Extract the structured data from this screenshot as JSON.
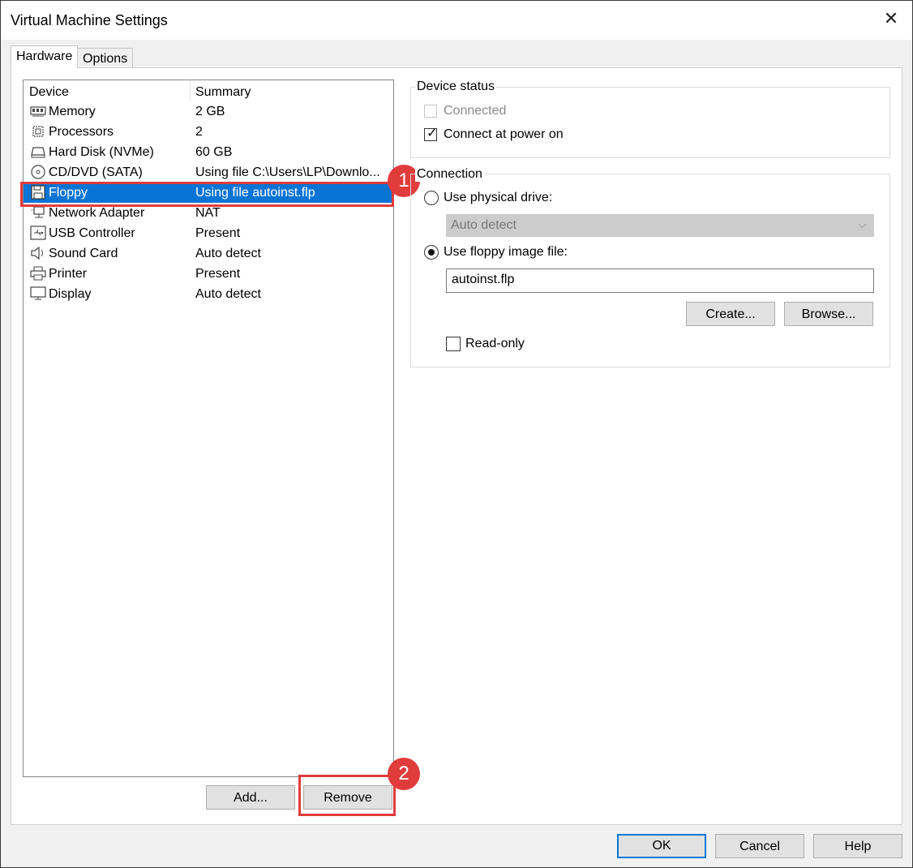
{
  "window": {
    "title": "Virtual Machine Settings",
    "close_glyph": "✕"
  },
  "tabs": [
    {
      "label": "Hardware",
      "active": true
    },
    {
      "label": "Options",
      "active": false
    }
  ],
  "device_list": {
    "columns": {
      "device": "Device",
      "summary": "Summary"
    },
    "items": [
      {
        "name": "Memory",
        "summary": "2 GB",
        "icon": "memory-icon"
      },
      {
        "name": "Processors",
        "summary": "2",
        "icon": "processor-icon"
      },
      {
        "name": "Hard Disk (NVMe)",
        "summary": "60 GB",
        "icon": "hard-disk-icon"
      },
      {
        "name": "CD/DVD (SATA)",
        "summary": "Using file C:\\Users\\LP\\Downlo...",
        "icon": "cd-dvd-icon"
      },
      {
        "name": "Floppy",
        "summary": "Using file autoinst.flp",
        "icon": "floppy-icon",
        "selected": true
      },
      {
        "name": "Network Adapter",
        "summary": "NAT",
        "icon": "network-adapter-icon"
      },
      {
        "name": "USB Controller",
        "summary": "Present",
        "icon": "usb-icon"
      },
      {
        "name": "Sound Card",
        "summary": "Auto detect",
        "icon": "speaker-icon"
      },
      {
        "name": "Printer",
        "summary": "Present",
        "icon": "printer-icon"
      },
      {
        "name": "Display",
        "summary": "Auto detect",
        "icon": "monitor-icon"
      }
    ],
    "add_label": "Add...",
    "remove_label": "Remove"
  },
  "annotations": {
    "badge1": "1",
    "badge2": "2",
    "color": "#e03c3c"
  },
  "device_status": {
    "title": "Device status",
    "connected_label": "Connected",
    "connected_checked": false,
    "connected_enabled": false,
    "power_on_label": "Connect at power on",
    "power_on_checked": true,
    "check_glyph": "✓"
  },
  "connection": {
    "title": "Connection",
    "physical_label": "Use physical drive:",
    "physical_selected": false,
    "drive_value": "Auto detect",
    "chevron_glyph": "⌵",
    "image_label": "Use floppy image file:",
    "image_selected": true,
    "image_file": "autoinst.flp",
    "create_label": "Create...",
    "browse_label": "Browse...",
    "readonly_label": "Read-only",
    "readonly_checked": false
  },
  "footer": {
    "ok_label": "OK",
    "cancel_label": "Cancel",
    "help_label": "Help"
  },
  "colors": {
    "selection": "#0a74d4",
    "accent_border": "#0078d7"
  }
}
